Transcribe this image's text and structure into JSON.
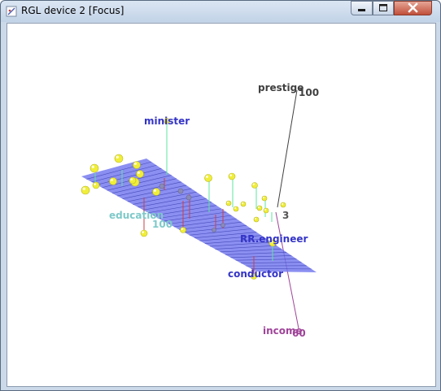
{
  "window": {
    "title": "RGL device 2 [Focus]"
  },
  "colors": {
    "plane": "#7276ee",
    "plane_lines": "#3a3fb0",
    "points": "#f0ee3a",
    "point_labels": "#3434c8",
    "education_axis": "#7fc9c9",
    "prestige_axis": "#404040",
    "income_axis": "#a0449a",
    "residual_up": "#5ee6a0",
    "residual_down": "#c8404a"
  },
  "plot": {
    "axes": {
      "prestige": {
        "label": "prestige",
        "tick": "100"
      },
      "education": {
        "label": "education",
        "tick": "100"
      },
      "income": {
        "label": "income",
        "tick": "60"
      },
      "origin_tick": "3"
    },
    "point_labels": [
      "minister",
      "RR.engineer",
      "conductor"
    ]
  },
  "icons": {
    "app": "rgl-app-icon",
    "minimize": "minimize-icon",
    "maximize": "maximize-icon",
    "close": "close-icon"
  }
}
